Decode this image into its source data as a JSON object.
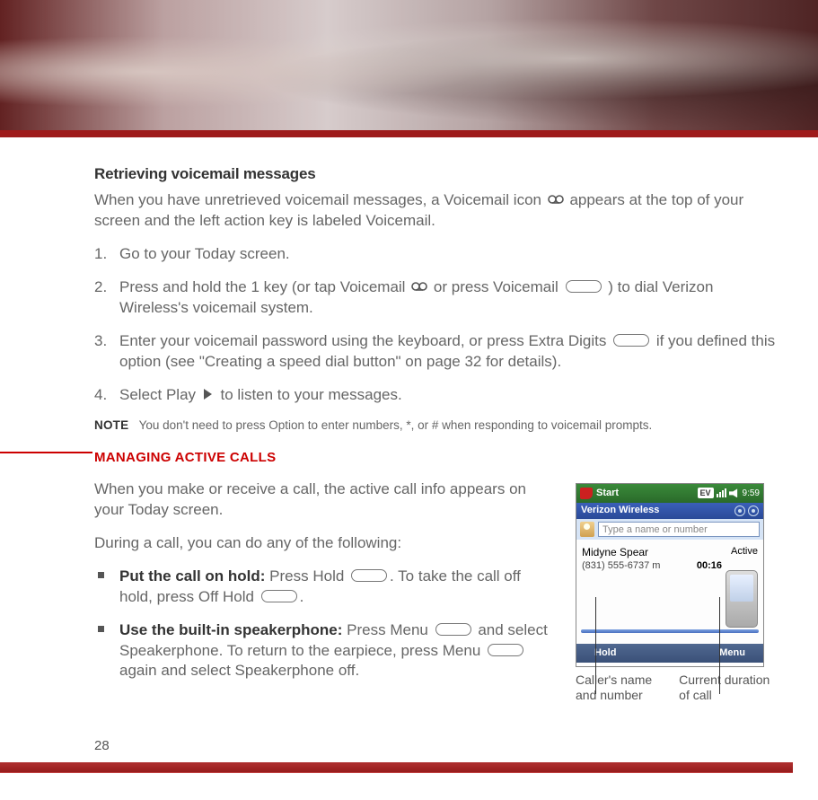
{
  "page_number": "28",
  "h1": "Retrieving voicemail messages",
  "intro_a": "When you have unretrieved voicemail messages, a Voicemail icon ",
  "intro_b": " appears at the top of your screen and the left action key is labeled Voicemail.",
  "steps": {
    "s1": "Go to your Today screen.",
    "s2a": "Press and hold the 1 key (or tap Voicemail ",
    "s2b": " or press Voicemail ",
    "s2c": ") to dial Verizon Wireless's voicemail system.",
    "s3a": "Enter your voicemail password using the keyboard, or press Extra Digits ",
    "s3b": " if you defined this option (see \"Creating a speed dial button\" on page 32 for details).",
    "s4a": "Select Play ",
    "s4b": " to listen to your messages."
  },
  "note_label": "NOTE",
  "note_text": "You don't need to press Option to enter numbers, *, or # when responding to voicemail prompts.",
  "section_heading": "MANAGING ACTIVE CALLS",
  "body": {
    "p1": "When you make or receive a call, the active call info appears on your Today screen.",
    "p2": "During a call, you can do any of the following:",
    "b1_label": "Put the call on hold: ",
    "b1a": "Press Hold ",
    "b1b": ". To take the call off hold, press Off Hold ",
    "b1c": ".",
    "b2_label": "Use the built-in speakerphone: ",
    "b2a": "Press Menu ",
    "b2b": " and select Speakerphone. To return to the earpiece, press Menu ",
    "b2c": " again and select Speakerphone off."
  },
  "phone": {
    "start": "Start",
    "ev": "EV",
    "time": "9:59",
    "carrier": "Verizon Wireless",
    "placeholder": "Type a name or number",
    "caller_name": "Midyne Spear",
    "status": "Active",
    "caller_number": "(831) 555-6737 m",
    "duration": "00:16",
    "soft_left": "Hold",
    "soft_right": "Menu"
  },
  "captions": {
    "c1a": "Caller's name",
    "c1b": "and number",
    "c2a": "Current duration",
    "c2b": "of call"
  }
}
